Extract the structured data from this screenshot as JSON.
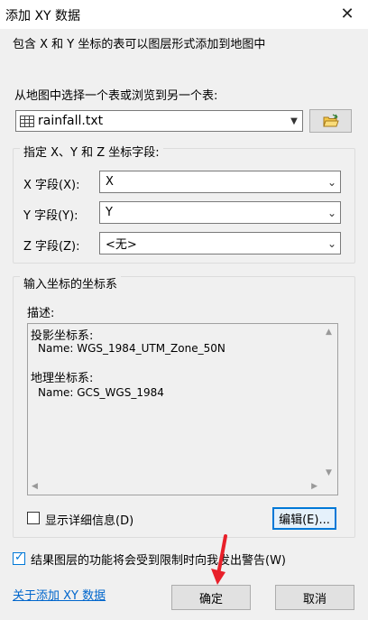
{
  "window": {
    "title": "添加 XY 数据",
    "close_symbol": "✕"
  },
  "description": "包含 X 和 Y 坐标的表可以图层形式添加到地图中",
  "table_select": {
    "label": "从地图中选择一个表或浏览到另一个表:",
    "value": "rainfall.txt",
    "icon": "table-icon",
    "browse_icon": "open-folder-icon"
  },
  "coordinate_fields": {
    "title": "指定 X、Y 和 Z 坐标字段:",
    "x_label": "X 字段(X):",
    "x_value": "X",
    "y_label": "Y 字段(Y):",
    "y_value": "Y",
    "z_label": "Z 字段(Z):",
    "z_value": "<无>"
  },
  "coordinate_system": {
    "title": "输入坐标的坐标系",
    "desc_label": "描述:",
    "projected_label": "投影坐标系:",
    "projected_name": "Name: WGS_1984_UTM_Zone_50N",
    "geographic_label": "地理坐标系:",
    "geographic_name": "Name: GCS_WGS_1984",
    "show_details_label": "显示详细信息(D)",
    "show_details_checked": false,
    "edit_label": "编辑(E)..."
  },
  "warning_checkbox": {
    "label": "结果图层的功能将会受到限制时向我发出警告(W)",
    "checked": true
  },
  "about_link": "关于添加 XY 数据",
  "buttons": {
    "ok": "确定",
    "cancel": "取消"
  },
  "colors": {
    "accent": "#0078d7",
    "link": "#0066cc",
    "arrow": "#e8202a"
  }
}
